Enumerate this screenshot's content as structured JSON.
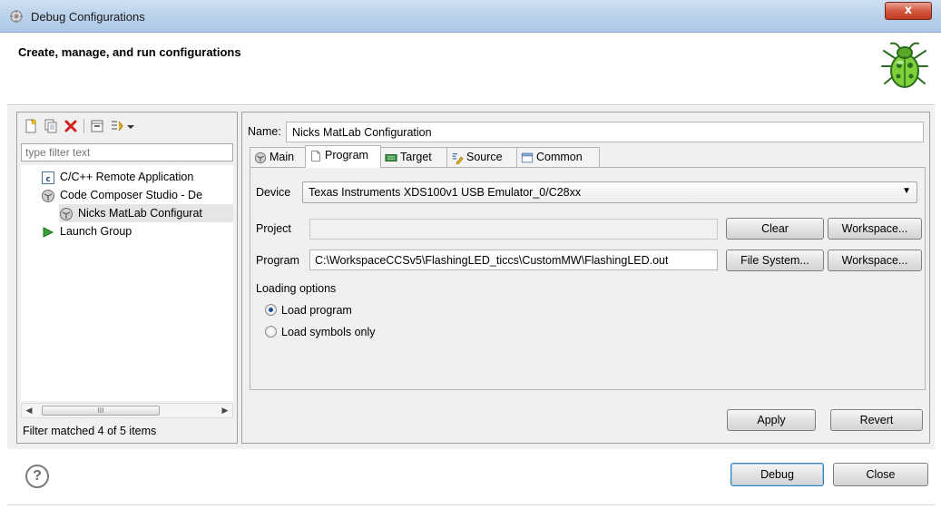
{
  "window": {
    "title": "Debug Configurations",
    "close_label": "x"
  },
  "banner": {
    "title": "Create, manage, and run configurations",
    "logo_icon": "bug-logo-icon"
  },
  "left_pane": {
    "toolbar_icons": [
      "new-configuration-icon",
      "duplicate-icon",
      "delete-icon",
      "collapse-all-icon",
      "filter-icon",
      "dropdown-arrow-icon"
    ],
    "filter_placeholder": "type filter text",
    "tree": [
      {
        "label": "C/C++ Remote Application",
        "icon": "c-file-icon",
        "level": 0
      },
      {
        "label": "Code Composer Studio - De",
        "icon": "ccs-icon",
        "level": 0
      },
      {
        "label": "Nicks MatLab Configurat",
        "icon": "ccs-icon",
        "level": 1,
        "selected": true
      },
      {
        "label": "Launch Group",
        "icon": "launch-arrow-icon",
        "level": 0
      }
    ],
    "scrollbar_grip": "III",
    "status": "Filter matched 4 of 5 items"
  },
  "right_pane": {
    "name_label": "Name:",
    "name_value": "Nicks MatLab Configuration",
    "tabs": [
      {
        "label": "Main",
        "icon": "ccs-icon"
      },
      {
        "label": "Program",
        "icon": "page-icon",
        "active": true
      },
      {
        "label": "Target",
        "icon": "chip-icon"
      },
      {
        "label": "Source",
        "icon": "source-icon"
      },
      {
        "label": "Common",
        "icon": "window-icon"
      }
    ],
    "device_label": "Device",
    "device_value": "Texas Instruments XDS100v1 USB Emulator_0/C28xx",
    "project_label": "Project",
    "project_value": "",
    "clear_label": "Clear",
    "workspace_label_1": "Workspace...",
    "program_label": "Program",
    "program_value": "C:\\WorkspaceCCSv5\\FlashingLED_ticcs\\CustomMW\\FlashingLED.out",
    "file_system_label": "File System...",
    "workspace_label_2": "Workspace...",
    "loading_options_label": "Loading options",
    "radio_load_program": "Load program",
    "radio_load_symbols": "Load symbols only",
    "load_program_selected": true,
    "apply_label": "Apply",
    "revert_label": "Revert"
  },
  "footer": {
    "help_glyph": "?",
    "debug_label": "Debug",
    "close_label": "Close"
  },
  "colors": {
    "title_bar": "#b9d1ea",
    "close_button": "#c03b22",
    "panel_bg": "#f0f0f0",
    "border": "#a0a0a0",
    "radio_dot": "#1d4f8f",
    "delete_red": "#d42020",
    "launch_green": "#3aa23a"
  }
}
